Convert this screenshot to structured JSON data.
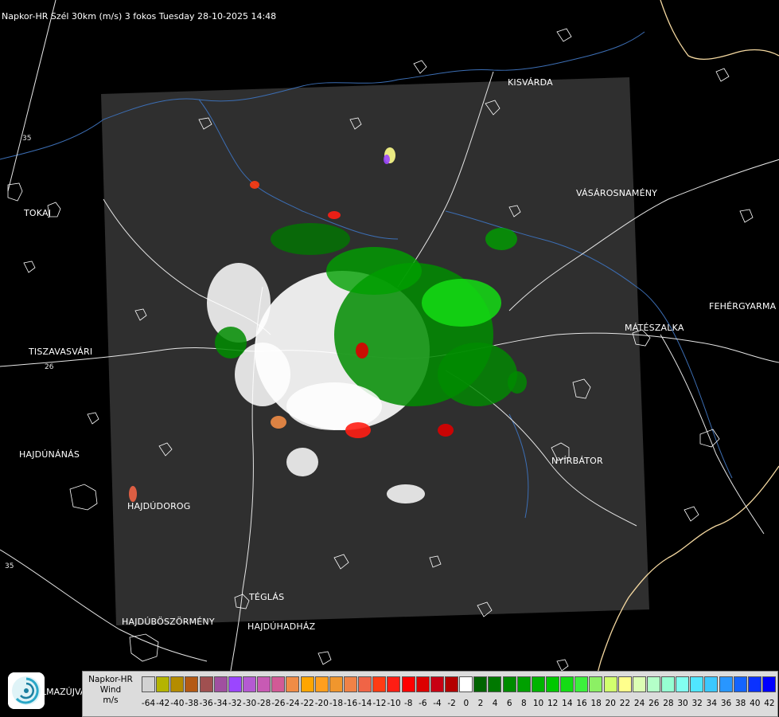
{
  "title": "Napkor-HR Szél 30km (m/s) 3 fokos Tuesday 28-10-2025 14:48",
  "cities": [
    {
      "id": "kisvarda",
      "name": "KISVÁRDA"
    },
    {
      "id": "vasarosnameny",
      "name": "VÁSÁROSNAMÉNY"
    },
    {
      "id": "tokaj",
      "name": "TOKAJ"
    },
    {
      "id": "fehergyarmat",
      "name": "FEHÉRGYARMA"
    },
    {
      "id": "mateszalka",
      "name": "MÁTÉSZALKA"
    },
    {
      "id": "tiszavasvari",
      "name": "TISZAVASVÁRI"
    },
    {
      "id": "nyirbator",
      "name": "NYÍRBÁTOR"
    },
    {
      "id": "hajdunanas",
      "name": "HAJDÚNÁNÁS"
    },
    {
      "id": "hajdudorog",
      "name": "HAJDÚDOROG"
    },
    {
      "id": "teglas",
      "name": "TÉGLÁS"
    },
    {
      "id": "hajduboszormeny",
      "name": "HAJDÚBÖSZÖRMÉNY"
    },
    {
      "id": "hajduhadhaz",
      "name": "HAJDÚHADHÁZ"
    }
  ],
  "road_numbers": [
    "35",
    "26",
    "35"
  ],
  "legend": {
    "line1": "Napkor-HR",
    "line2": "Wind",
    "line3": "m/s",
    "ticks": [
      "-64",
      "-42",
      "-40",
      "-38",
      "-36",
      "-34",
      "-32",
      "-30",
      "-28",
      "-26",
      "-24",
      "-22",
      "-20",
      "-18",
      "-16",
      "-14",
      "-12",
      "-10",
      "-8",
      "-6",
      "-4",
      "-2",
      "0",
      "2",
      "4",
      "6",
      "8",
      "10",
      "12",
      "14",
      "16",
      "18",
      "20",
      "22",
      "24",
      "26",
      "28",
      "30",
      "32",
      "34",
      "36",
      "38",
      "40",
      "42"
    ],
    "colors": [
      "#d2d2d2",
      "#b4b400",
      "#b48c00",
      "#b45a14",
      "#a05050",
      "#a050a0",
      "#9b46ff",
      "#b45ad2",
      "#c85ab4",
      "#d25a96",
      "#f08c46",
      "#ffa500",
      "#ff9f1e",
      "#f0962d",
      "#f08246",
      "#f06446",
      "#ff3c14",
      "#ff1e14",
      "#ff0000",
      "#dc0000",
      "#c80014",
      "#b40000",
      "#ffffff",
      "#006400",
      "#007800",
      "#008c00",
      "#00a000",
      "#00b400",
      "#00c800",
      "#14dc14",
      "#3cf03c",
      "#8cf064",
      "#d2ff6e",
      "#ffff8c",
      "#dcffb4",
      "#b4ffc8",
      "#96ffd2",
      "#82fff0",
      "#50e6ff",
      "#3cc8ff",
      "#2896ff",
      "#1464ff",
      "#0a32ff",
      "#0000ff"
    ]
  },
  "logo_text": "LMAZÚJVÁR"
}
